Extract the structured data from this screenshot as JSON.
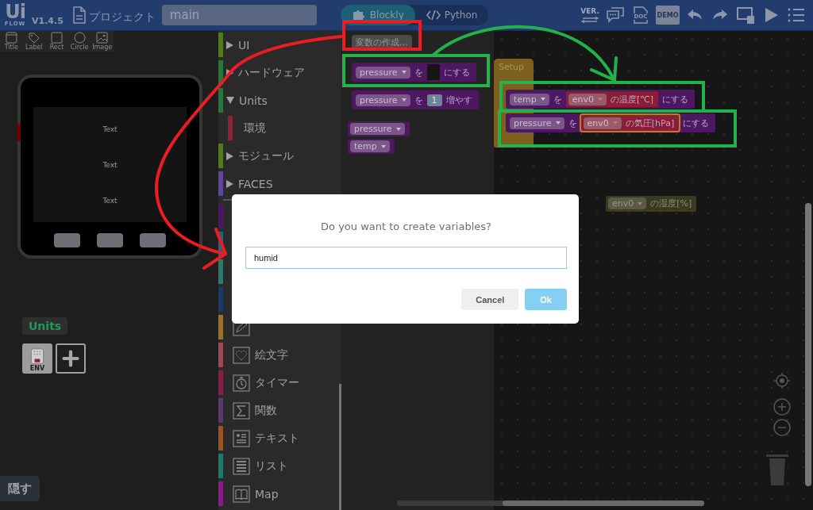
{
  "app": {
    "logo": "Ui",
    "logo_sub": "FLOW",
    "version": "V1.4.5",
    "project_label": "プロジェクト",
    "project_name": "main"
  },
  "mode_tabs": [
    {
      "label": "Blockly",
      "selected": true
    },
    {
      "label": "Python",
      "selected": false
    }
  ],
  "toolbar": [
    {
      "kind": "version",
      "label": "VER."
    },
    {
      "kind": "chat"
    },
    {
      "kind": "doc",
      "label": "DOC"
    },
    {
      "kind": "demo",
      "label": "DEMO"
    },
    {
      "kind": "undo"
    },
    {
      "kind": "redo"
    },
    {
      "kind": "device"
    },
    {
      "kind": "run"
    },
    {
      "kind": "menu"
    }
  ],
  "palette": [
    {
      "kind": "title",
      "label": "Title"
    },
    {
      "kind": "label",
      "label": "Label"
    },
    {
      "kind": "rect",
      "label": "Rect"
    },
    {
      "kind": "circle",
      "label": "Circle"
    },
    {
      "kind": "image",
      "label": "Image"
    }
  ],
  "device": {
    "screen_texts": [
      "Text",
      "Text",
      "Text"
    ]
  },
  "units": {
    "title": "Units",
    "items": [
      {
        "kind": "unit",
        "label": "ENV"
      },
      {
        "kind": "add"
      }
    ]
  },
  "hide_button": "隠す",
  "categories": [
    {
      "kind": "group",
      "label": "UI",
      "expanded": false,
      "color": "#4f7a16"
    },
    {
      "kind": "group",
      "label": "ハードウェア",
      "expanded": false,
      "color": "#27773a"
    },
    {
      "kind": "group",
      "label": "Units",
      "expanded": true,
      "color": "#27773a",
      "children": [
        {
          "kind": "sub",
          "label": "環境",
          "color": "#8a2438"
        }
      ]
    },
    {
      "kind": "group",
      "label": "モジュール",
      "expanded": false,
      "color": "#4f7a16"
    },
    {
      "kind": "group",
      "label": "FACES",
      "expanded": false,
      "color": "#5e479a"
    },
    {
      "kind": "hidden",
      "color": "#4a1760"
    },
    {
      "kind": "hidden",
      "color": "#1d6585"
    },
    {
      "kind": "hidden",
      "color": "#2c7a6a"
    },
    {
      "kind": "hidden",
      "color": "#1b3a6a"
    },
    {
      "kind": "icon",
      "color": "#9a7322"
    },
    {
      "kind": "icon",
      "label": "絵文字",
      "color": "#9a4a56"
    },
    {
      "kind": "icon",
      "label": "タイマー",
      "color": "#8a1c48"
    },
    {
      "kind": "icon",
      "label": "関数",
      "color": "#5a3a6a"
    },
    {
      "kind": "icon",
      "label": "テキスト",
      "color": "#9a5220"
    },
    {
      "kind": "icon",
      "label": "リスト",
      "color": "#1c7a6a"
    },
    {
      "kind": "icon",
      "label": "Map",
      "color": "#8a1a8a"
    }
  ],
  "flyout": {
    "create_button": "変数の作成…",
    "blocks": [
      {
        "kind": "statement",
        "parts": [
          {
            "kind": "dropdown",
            "text": "pressure"
          },
          {
            "kind": "label",
            "text": "を"
          },
          {
            "kind": "slot"
          },
          {
            "kind": "label",
            "text": "にする"
          }
        ]
      },
      {
        "kind": "statement",
        "parts": [
          {
            "kind": "dropdown",
            "text": "pressure"
          },
          {
            "kind": "label",
            "text": "を"
          },
          {
            "kind": "number",
            "text": "1"
          },
          {
            "kind": "label",
            "text": "増やす"
          }
        ]
      },
      {
        "kind": "reporter",
        "parts": [
          {
            "kind": "dropdown",
            "text": "pressure"
          }
        ]
      },
      {
        "kind": "reporter",
        "parts": [
          {
            "kind": "dropdown",
            "text": "temp"
          }
        ]
      }
    ]
  },
  "workspace": {
    "blocks": [
      {
        "kind": "hat",
        "label": "Setup",
        "children": [
          {
            "kind": "statement",
            "parts": [
              {
                "kind": "dropdown",
                "text": "temp"
              },
              {
                "kind": "label",
                "text": "を"
              },
              {
                "kind": "sensor",
                "selected": false,
                "parts": [
                  {
                    "kind": "dropdown",
                    "text": "env0"
                  },
                  {
                    "kind": "label",
                    "text": "の温度[℃]"
                  }
                ]
              },
              {
                "kind": "label",
                "text": "にする"
              }
            ]
          },
          {
            "kind": "statement",
            "parts": [
              {
                "kind": "dropdown",
                "text": "pressure"
              },
              {
                "kind": "label",
                "text": "を"
              },
              {
                "kind": "sensor",
                "selected": true,
                "parts": [
                  {
                    "kind": "dropdown",
                    "text": "env0"
                  },
                  {
                    "kind": "label",
                    "text": "の気圧[hPa]"
                  }
                ]
              },
              {
                "kind": "label",
                "text": "にする"
              }
            ]
          }
        ]
      },
      {
        "kind": "sensor",
        "disabled": true,
        "parts": [
          {
            "kind": "dropdown",
            "text": "env0"
          },
          {
            "kind": "label",
            "text": "の湿度[%]"
          }
        ]
      }
    ]
  },
  "dialog": {
    "message": "Do you want to create variables?",
    "value": "humid",
    "buttons": [
      {
        "kind": "cancel",
        "label": "Cancel"
      },
      {
        "kind": "ok",
        "label": "Ok"
      }
    ]
  }
}
